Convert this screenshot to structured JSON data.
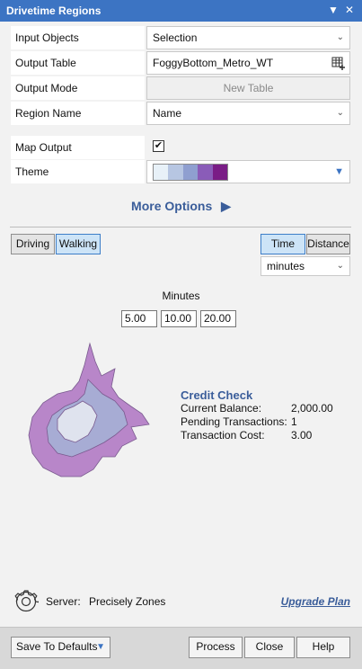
{
  "window": {
    "title": "Drivetime Regions",
    "controls": [
      "▼",
      "✕"
    ]
  },
  "form": {
    "input_objects": {
      "label": "Input Objects",
      "value": "Selection"
    },
    "output_table": {
      "label": "Output Table",
      "value": "FoggyBottom_Metro_WT"
    },
    "output_mode": {
      "label": "Output Mode",
      "value": "New Table"
    },
    "region_name": {
      "label": "Region Name",
      "value": "Name"
    },
    "map_output": {
      "label": "Map Output",
      "checked": true,
      "check_glyph": "✔"
    },
    "theme": {
      "label": "Theme",
      "swatches": [
        "#e8f1f8",
        "#b7c6e2",
        "#8f9fd0",
        "#8a5cb8",
        "#7a1d86"
      ]
    }
  },
  "more_options": {
    "label": "More Options",
    "arrow": "▶"
  },
  "mode_buttons": {
    "driving": "Driving",
    "walking": "Walking",
    "selected": "Walking"
  },
  "unit_buttons": {
    "time": "Time",
    "distance": "Distance",
    "selected": "Time",
    "units_value": "minutes"
  },
  "minutes": {
    "title": "Minutes",
    "values": [
      "5.00",
      "10.00",
      "20.00"
    ]
  },
  "region_colors": {
    "outer": "#b886c9",
    "middle": "#a7acd4",
    "inner": "#dfe3ee",
    "stroke": "#7a5b8f"
  },
  "credit_check": {
    "title": "Credit Check",
    "rows": [
      {
        "label": "Current Balance:",
        "value": "2,000.00"
      },
      {
        "label": "Pending Transactions:",
        "value": "1"
      },
      {
        "label": "Transaction Cost:",
        "value": "3.00"
      }
    ]
  },
  "server": {
    "label": "Server:",
    "value": "Precisely Zones",
    "upgrade_label": "Upgrade Plan"
  },
  "footer": {
    "save_defaults": "Save To Defaults",
    "process": "Process",
    "close": "Close",
    "help": "Help"
  }
}
